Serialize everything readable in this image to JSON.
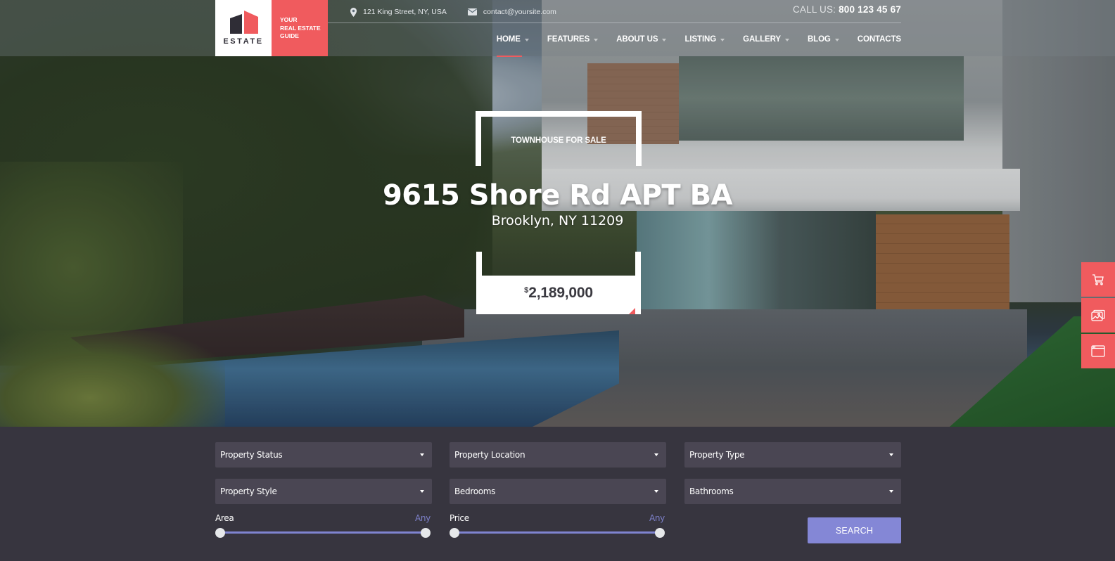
{
  "brand": {
    "logo_text": "ESTATE",
    "tagline_lines": [
      "YOUR",
      "REAL ESTATE",
      "GUIDE"
    ],
    "colors": {
      "accent": "#f05b5e",
      "dark": "#2f2d36",
      "panel": "#37353f",
      "field": "#4a4653",
      "button": "#8487d6"
    }
  },
  "header": {
    "address": {
      "icon": "map-marker-icon",
      "text": "121 King Street, NY, USA"
    },
    "email": {
      "icon": "envelope-icon",
      "text": "contact@yoursite.com"
    },
    "call_label": "CALL US:",
    "call_number": "800 123 45 67",
    "nav": [
      {
        "label": "HOME",
        "has_dropdown": true,
        "active": true
      },
      {
        "label": "FEATURES",
        "has_dropdown": true
      },
      {
        "label": "ABOUT US",
        "has_dropdown": true
      },
      {
        "label": "LISTING",
        "has_dropdown": true
      },
      {
        "label": "GALLERY",
        "has_dropdown": true
      },
      {
        "label": "BLOG",
        "has_dropdown": true
      },
      {
        "label": "CONTACTS",
        "has_dropdown": false
      }
    ]
  },
  "hero": {
    "badge": "TOWNHOUSE FOR SALE",
    "title": "9615 Shore Rd APT BA",
    "subtitle": "Brooklyn, NY 11209",
    "price_currency": "$",
    "price_value": "2,189,000"
  },
  "side_buttons": [
    {
      "icon": "shopping-cart-icon"
    },
    {
      "icon": "images-icon"
    },
    {
      "icon": "browser-window-icon"
    }
  ],
  "search": {
    "selects": [
      {
        "label": "Property Status"
      },
      {
        "label": "Property Location"
      },
      {
        "label": "Property Type"
      },
      {
        "label": "Property Style"
      },
      {
        "label": "Bedrooms"
      },
      {
        "label": "Bathrooms"
      }
    ],
    "ranges": [
      {
        "label": "Area",
        "value_text": "Any",
        "min_fraction": 0,
        "max_fraction": 1
      },
      {
        "label": "Price",
        "value_text": "Any",
        "min_fraction": 0,
        "max_fraction": 1
      }
    ],
    "submit_label": "SEARCH"
  }
}
